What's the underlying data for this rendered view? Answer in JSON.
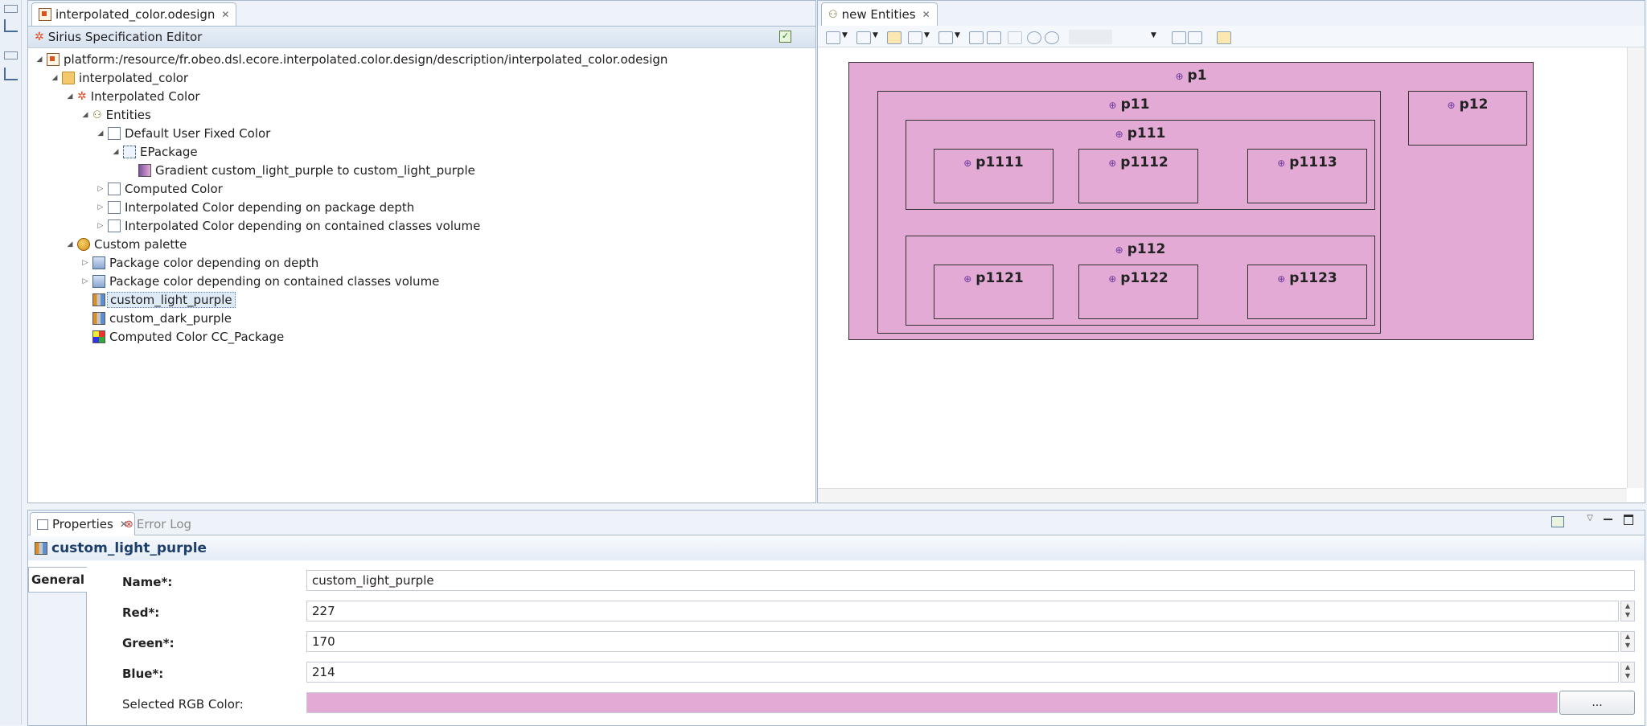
{
  "editor": {
    "tab_label": "interpolated_color.odesign",
    "header_title": "Sirius Specification Editor",
    "tree": [
      {
        "label": "platform:/resource/fr.obeo.dsl.ecore.interpolated.color.design/description/interpolated_color.odesign",
        "icon": "odesign-file-icon",
        "depth": 0,
        "twisty": "expanded"
      },
      {
        "label": "interpolated_color",
        "icon": "group-folder-icon",
        "depth": 1,
        "twisty": "expanded"
      },
      {
        "label": "Interpolated Color",
        "icon": "viewpoint-icon",
        "depth": 2,
        "twisty": "expanded"
      },
      {
        "label": "Entities",
        "icon": "diagram-description-icon",
        "depth": 3,
        "twisty": "expanded"
      },
      {
        "label": "Default User Fixed Color",
        "icon": "layer-icon",
        "depth": 4,
        "twisty": "expanded"
      },
      {
        "label": "EPackage",
        "icon": "container-mapping-icon",
        "depth": 5,
        "twisty": "expanded"
      },
      {
        "label": "Gradient custom_light_purple to custom_light_purple",
        "icon": "gradient-style-icon",
        "depth": 6,
        "twisty": "none"
      },
      {
        "label": "Computed Color",
        "icon": "layer-icon",
        "depth": 4,
        "twisty": "collapsed"
      },
      {
        "label": "Interpolated Color depending on package depth",
        "icon": "layer-icon",
        "depth": 4,
        "twisty": "collapsed"
      },
      {
        "label": "Interpolated Color depending on contained classes volume",
        "icon": "layer-icon",
        "depth": 4,
        "twisty": "collapsed"
      },
      {
        "label": "Custom palette",
        "icon": "palette-icon",
        "depth": 2,
        "twisty": "expanded"
      },
      {
        "label": "Package color depending on depth",
        "icon": "interpolated-color-icon",
        "depth": 3,
        "twisty": "collapsed"
      },
      {
        "label": "Package color depending on contained classes volume",
        "icon": "interpolated-color-icon",
        "depth": 3,
        "twisty": "collapsed"
      },
      {
        "label": "custom_light_purple",
        "icon": "user-color-icon",
        "depth": 3,
        "twisty": "none",
        "selected": true
      },
      {
        "label": "custom_dark_purple",
        "icon": "user-color-icon",
        "depth": 3,
        "twisty": "none"
      },
      {
        "label": "Computed Color CC_Package",
        "icon": "computed-color-icon",
        "depth": 3,
        "twisty": "none"
      }
    ]
  },
  "diagram": {
    "tab_label": "new Entities",
    "nodes": {
      "p1": "p1",
      "p11": "p11",
      "p12": "p12",
      "p111": "p111",
      "p1111": "p1111",
      "p1112": "p1112",
      "p1113": "p1113",
      "p112": "p112",
      "p1121": "p1121",
      "p1122": "p1122",
      "p1123": "p1123"
    },
    "node_color": "#e3aad6"
  },
  "properties": {
    "tab_label": "Properties",
    "error_log_label": "Error Log",
    "title": "custom_light_purple",
    "section_tab": "General",
    "fields": {
      "name_label": "Name*:",
      "name_value": "custom_light_purple",
      "red_label": "Red*:",
      "red_value": "227",
      "green_label": "Green*:",
      "green_value": "170",
      "blue_label": "Blue*:",
      "blue_value": "214",
      "rgb_label": "Selected RGB Color:",
      "rgb_color": "#e3aad6",
      "browse_label": "..."
    }
  }
}
